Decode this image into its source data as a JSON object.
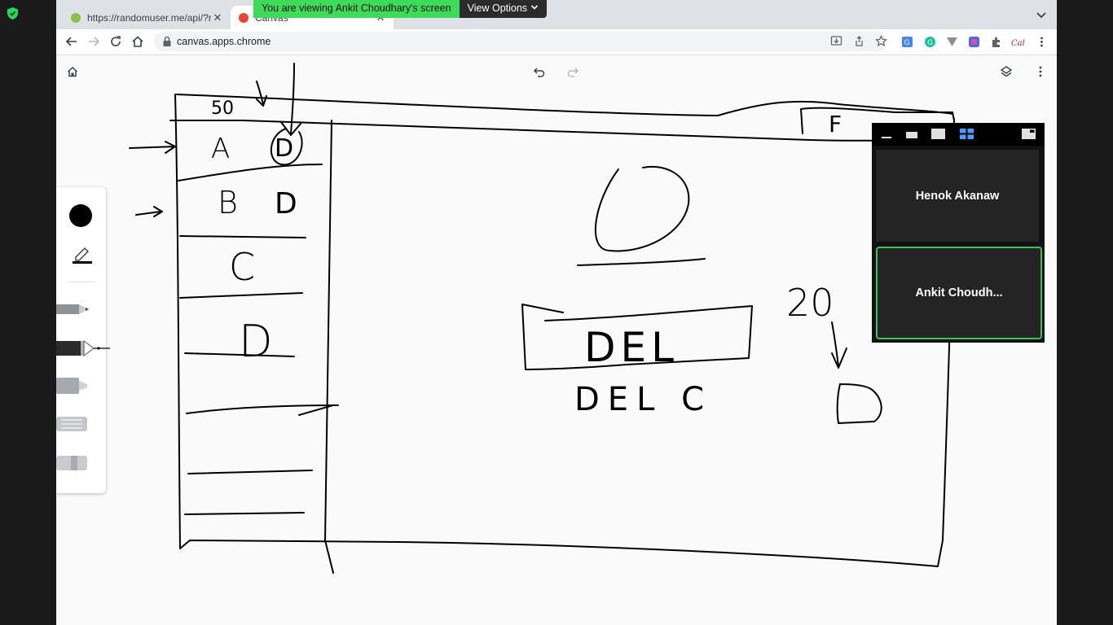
{
  "browser": {
    "tabs": [
      {
        "title": "https://randomuser.me/api/?re",
        "favicon": "randomuser-favicon",
        "active": false
      },
      {
        "title": "Canvas",
        "favicon": "canvas-favicon",
        "active": true
      }
    ],
    "address": "canvas.apps.chrome"
  },
  "share_banner": {
    "message": "You are viewing Ankit Choudhary's screen",
    "options_label": "View Options"
  },
  "pen_panel": {
    "selected_color": "#000000",
    "tools": [
      "pencil",
      "pen",
      "marker",
      "chalk",
      "eraser"
    ],
    "selected_tool": "pen"
  },
  "participants": [
    {
      "name": "Henok Akanaw",
      "active_speaker": false
    },
    {
      "name": "Ankit Choudh...",
      "active_speaker": true
    }
  ],
  "drawing_text": {
    "top_number": "50",
    "row_a": "A",
    "row_a_mark": "D",
    "row_b": "B",
    "row_b_mark": "D",
    "row_c": "C",
    "row_d": "D",
    "header_right": "F",
    "center_letter": "D",
    "box_text": "DEL",
    "below_box": "DEL C",
    "number_right": "20",
    "result_letter": "D"
  },
  "colors": {
    "banner_green": "#3ddc58",
    "active_tile_border": "#35c759",
    "layout_selected": "#4a9eff"
  }
}
